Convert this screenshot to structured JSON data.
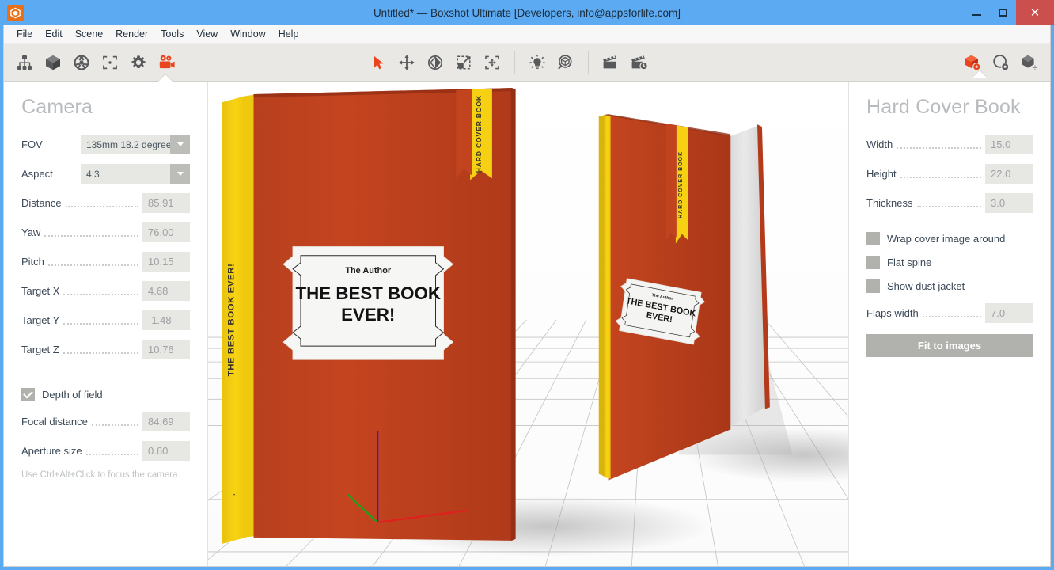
{
  "window": {
    "title": "Untitled* — Boxshot Ultimate [Developers, info@appsforlife.com]",
    "app_icon": "boxshot-logo-icon",
    "controls": {
      "minimize": "minimize-icon",
      "maximize": "maximize-icon",
      "close": "close-icon"
    },
    "accent_color": "#5CAAF2",
    "close_color": "#CB4F4C"
  },
  "menubar": {
    "items": [
      "File",
      "Edit",
      "Scene",
      "Render",
      "Tools",
      "View",
      "Window",
      "Help"
    ]
  },
  "toolbar": {
    "left": [
      {
        "name": "scene-tree-icon",
        "active": false
      },
      {
        "name": "shape-box-icon",
        "active": false
      },
      {
        "name": "materials-sphere-icon",
        "active": false
      },
      {
        "name": "focus-brackets-icon",
        "active": false
      },
      {
        "name": "settings-gear-icon",
        "active": false
      },
      {
        "name": "camera-icon",
        "active": true
      }
    ],
    "center": [
      {
        "name": "select-arrow-tool-icon",
        "active": true
      },
      {
        "name": "move-tool-icon",
        "active": false
      },
      {
        "name": "rotate-tool-icon",
        "active": false
      },
      {
        "name": "scale-tool-icon",
        "active": false
      },
      {
        "name": "center-tool-icon",
        "active": false
      },
      {
        "name": "light-bulb-icon",
        "active": false
      },
      {
        "name": "zoom-to-object-icon",
        "active": false
      },
      {
        "name": "render-clapperboard-icon",
        "active": false
      },
      {
        "name": "render-animation-icon",
        "active": false
      }
    ],
    "right": [
      {
        "name": "object-settings-icon",
        "active": true
      },
      {
        "name": "material-settings-icon",
        "active": false
      },
      {
        "name": "object-transform-icon",
        "active": false
      }
    ],
    "active_color": "#E8441E"
  },
  "camera_panel": {
    "title": "Camera",
    "fov": {
      "label": "FOV",
      "value": "135mm 18.2 degrees"
    },
    "aspect": {
      "label": "Aspect",
      "value": "4:3"
    },
    "fields": [
      {
        "label": "Distance",
        "value": "85.91"
      },
      {
        "label": "Yaw",
        "value": "76.00"
      },
      {
        "label": "Pitch",
        "value": "10.15"
      },
      {
        "label": "Target X",
        "value": "4.68"
      },
      {
        "label": "Target Y",
        "value": "-1.48"
      },
      {
        "label": "Target Z",
        "value": "10.76"
      }
    ],
    "depth_of_field": {
      "label": "Depth of field",
      "checked": true
    },
    "focal_distance": {
      "label": "Focal distance",
      "value": "84.69"
    },
    "aperture_size": {
      "label": "Aperture size",
      "value": "0.60"
    },
    "hint": "Use Ctrl+Alt+Click to focus the camera"
  },
  "object_panel": {
    "title": "Hard Cover Book",
    "fields": [
      {
        "label": "Width",
        "value": "15.0"
      },
      {
        "label": "Height",
        "value": "22.0"
      },
      {
        "label": "Thickness",
        "value": "3.0"
      }
    ],
    "checkboxes": [
      {
        "label": "Wrap cover image around",
        "checked": false
      },
      {
        "label": "Flat spine",
        "checked": false
      },
      {
        "label": "Show dust jacket",
        "checked": false
      }
    ],
    "flaps_width": {
      "label": "Flaps width",
      "value": "7.0"
    },
    "fit_button": "Fit to images"
  },
  "viewport": {
    "name": "3d-viewport",
    "book_cover_color": "#C1441F",
    "book_spine_color": "#F5CD12",
    "book_front": {
      "author": "The Author",
      "title_line1": "THE BEST BOOK",
      "title_line2": "EVER!",
      "spine_text": "THE BEST BOOK EVER!",
      "ribbon_text": "HARD COVER BOOK"
    },
    "book_back": {
      "author": "The Author",
      "title_line1": "THE BEST BOOK",
      "title_line2": "EVER!",
      "ribbon_text": "HARD COVER BOOK"
    },
    "axis_gizmo": {
      "x_color": "#E02020",
      "y_color": "#19A319",
      "z_color": "#2222DD"
    }
  }
}
